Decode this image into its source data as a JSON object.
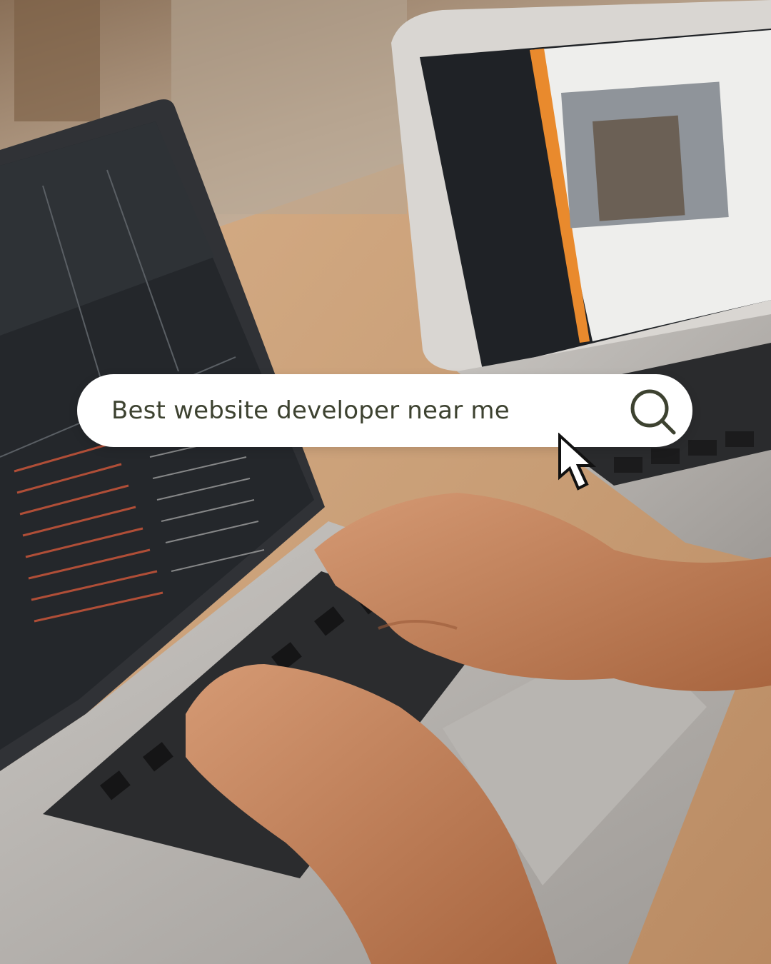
{
  "search": {
    "query": "Best website developer near me"
  },
  "icons": {
    "search": "search-icon",
    "cursor": "mouse-pointer-icon"
  },
  "colors": {
    "search_bar": "#ffffff",
    "search_text": "#3d4230",
    "search_icon": "#3d4230"
  }
}
